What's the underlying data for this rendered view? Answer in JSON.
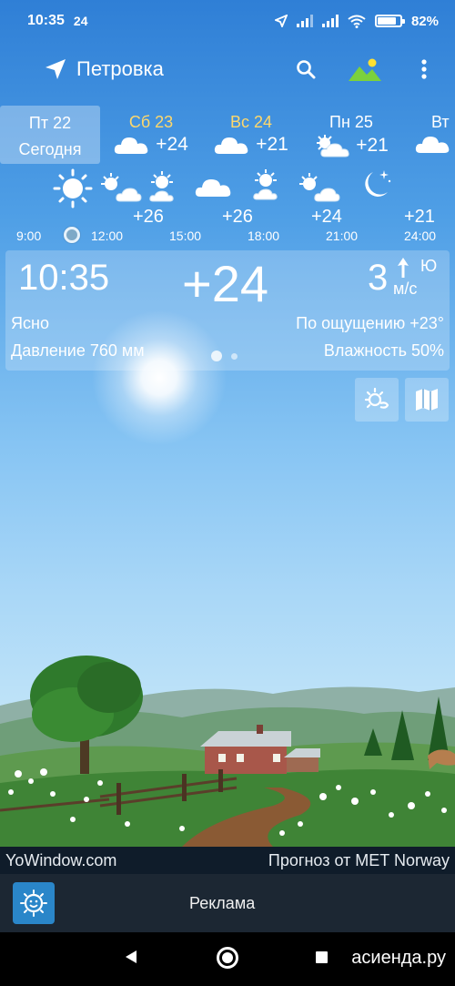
{
  "status_bar": {
    "time": "10:35",
    "temp_badge": "24",
    "battery": "82%",
    "battery_level": 0.82
  },
  "header": {
    "location": "Петровка"
  },
  "days": {
    "today": {
      "name": "Пт 22",
      "label": "Сегодня"
    },
    "list": [
      {
        "name": "Сб 23",
        "temp": "+24",
        "icon": "cloud-icon"
      },
      {
        "name": "Вс 24",
        "temp": "+21",
        "icon": "cloud-icon"
      },
      {
        "name": "Пн 25",
        "temp": "+21",
        "icon": "sun-cloud-icon"
      },
      {
        "name": "Вт",
        "temp": "",
        "icon": "cloud-icon"
      }
    ]
  },
  "hourly": {
    "temps": [
      "+26",
      "+26",
      "+24",
      "+21"
    ],
    "times": [
      "9:00",
      "12:00",
      "15:00",
      "18:00",
      "21:00",
      "24:00"
    ]
  },
  "current": {
    "time": "10:35",
    "temp": "+24",
    "wind_speed": "3",
    "wind_dir": "Ю",
    "wind_unit": "м/с",
    "condition": "Ясно",
    "feels_like": "По ощущению +23°",
    "pressure": "Давление 760 мм",
    "humidity": "Влажность 50%"
  },
  "footer": {
    "site": "YoWindow.com",
    "forecast_source": "Прогноз от MET Norway",
    "ad_label": "Реклама",
    "watermark": "асиенда.ру"
  },
  "colors": {
    "day_name_accent": "#ffd86b",
    "sky_top": "#2f7fd6",
    "credits_bg": "#0f1c2a",
    "ad_bg": "#1c2733"
  }
}
